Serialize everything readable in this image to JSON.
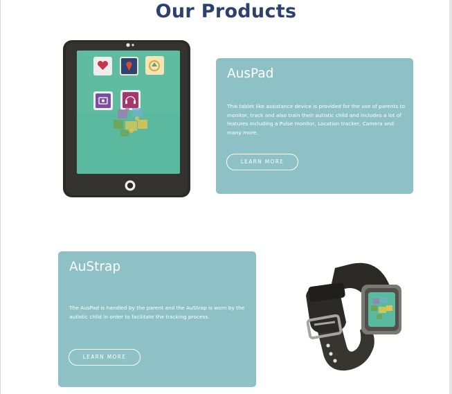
{
  "page": {
    "title": "Our Products"
  },
  "products": [
    {
      "name": "AusPad",
      "description": "This tablet like assistance device is provided for the use of parents to monitor, track and also train their autistic child and includes a lot of features including a Pulse monitor, Location tracker, Camera and many more.",
      "button_label": "LEARN MORE",
      "illustration": "tablet-illustration"
    },
    {
      "name": "AuStrap",
      "description": "The AusPad is handled by the parent and the AuStrap is worn by the autistic child in order to facilitate the tracking process.",
      "button_label": "LEARN MORE",
      "illustration": "smartwatch-illustration"
    }
  ],
  "colors": {
    "title": "#2d4170",
    "card_background": "#8ec1c5",
    "card_text": "#ffffff",
    "tablet_screen": "#5bb99f",
    "device_body": "#2b2a27"
  }
}
